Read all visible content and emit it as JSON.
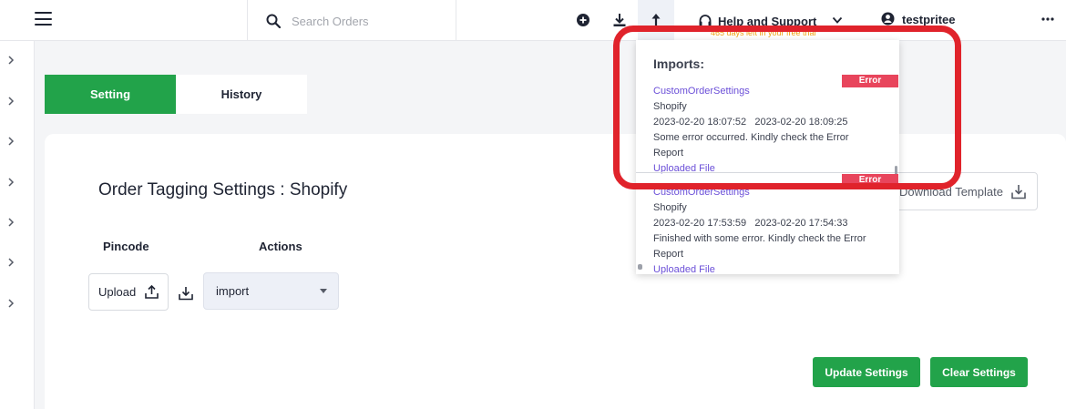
{
  "header": {
    "search_placeholder": "Search Orders",
    "help_label": "Help and Support",
    "trial_note": "465 days left in your free trial",
    "username": "testpritee"
  },
  "tabs": [
    {
      "label": "Setting",
      "active": true
    },
    {
      "label": "History",
      "active": false
    }
  ],
  "page": {
    "title": "Order Tagging Settings : Shopify",
    "columns": [
      "Pincode",
      "Actions"
    ],
    "upload_label": "Upload",
    "action_select_value": "import",
    "download_template_label": "Download Template",
    "update_button": "Update Settings",
    "clear_button": "Clear Settings"
  },
  "imports": {
    "title": "Imports:",
    "entries": [
      {
        "name": "CustomOrderSettings",
        "channel": "Shopify",
        "start": "2023-02-20 18:07:52",
        "end": "2023-02-20 18:09:25",
        "message": "Some error occurred. Kindly check the Error Report",
        "link": "Uploaded File",
        "status": "Error"
      },
      {
        "name": "CustomOrderSettings",
        "channel": "Shopify",
        "start": "2023-02-20 17:53:59",
        "end": "2023-02-20 17:54:33",
        "message": "Finished with some error. Kindly check the Error Report",
        "link": "Uploaded File",
        "status": "Error"
      }
    ]
  },
  "colors": {
    "accent_green": "#22a34a",
    "error_badge": "#e8455c",
    "link_purple": "#6b4fd8",
    "highlight_red": "#e0232b",
    "trial_orange": "#f0a010"
  },
  "icons": [
    "menu-icon",
    "search-icon",
    "add-circle-icon",
    "download-icon",
    "upload-icon",
    "headset-icon",
    "chevron-down-icon",
    "user-icon",
    "more-icon",
    "chevron-right-icon"
  ]
}
